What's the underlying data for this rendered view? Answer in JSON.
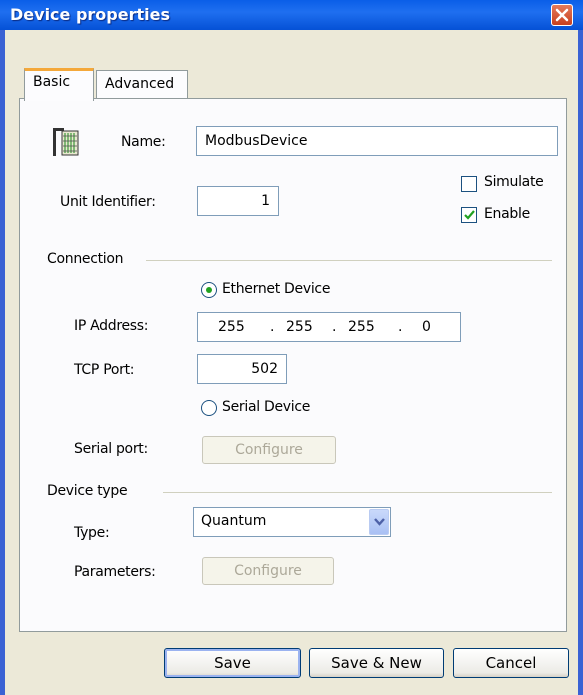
{
  "window": {
    "title": "Device properties"
  },
  "tabs": [
    {
      "label": "Basic",
      "active": true
    },
    {
      "label": "Advanced",
      "active": false
    }
  ],
  "basic": {
    "name_label": "Name:",
    "name_value": "ModbusDevice",
    "unit_id_label": "Unit Identifier:",
    "unit_id_value": "1",
    "simulate_label": "Simulate",
    "simulate_checked": false,
    "enable_label": "Enable",
    "enable_checked": true
  },
  "connection": {
    "section_label": "Connection",
    "ethernet_label": "Ethernet Device",
    "ethernet_selected": true,
    "ip_label": "IP Address:",
    "ip_octets": [
      "255",
      "255",
      "255",
      "0"
    ],
    "ip_separator": ".",
    "tcp_port_label": "TCP Port:",
    "tcp_port_value": "502",
    "serial_label": "Serial Device",
    "serial_selected": false,
    "serial_port_label": "Serial port:",
    "serial_configure_label": "Configure"
  },
  "device_type": {
    "section_label": "Device type",
    "type_label": "Type:",
    "type_value": "Quantum",
    "parameters_label": "Parameters:",
    "parameters_configure_label": "Configure"
  },
  "buttons": {
    "save": "Save",
    "save_new": "Save & New",
    "cancel": "Cancel"
  },
  "icons": {
    "device": "device-rack-icon",
    "close": "close-icon",
    "check": "checkmark-icon",
    "dropdown": "chevron-down-icon"
  },
  "colors": {
    "titlebar": "#0a5ee8",
    "dialog_bg": "#ece9d8",
    "tab_accent": "#f4a83a",
    "check": "#21a121",
    "close": "#c8401e"
  }
}
